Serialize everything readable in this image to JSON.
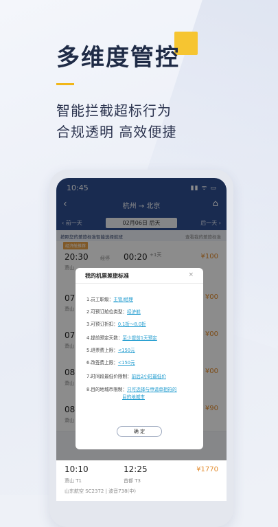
{
  "promo": {
    "headline": "多维度管控",
    "subline1": "智能拦截超标行为",
    "subline2": "合规透明 高效便捷"
  },
  "status": {
    "time": "10:45",
    "icons": "▮▮ ᯤ ▭"
  },
  "nav": {
    "back": "‹",
    "title": "杭州 → 北京",
    "home": "⌂"
  },
  "datebar": {
    "prev": "‹ 前一天",
    "current": "02月06日 后天",
    "next": "后一天 ›"
  },
  "notice": {
    "left": "按照您的差旅标准智能选择航班",
    "right": "查看我的差旅标准"
  },
  "tag": "经济舱推荐",
  "flights": [
    {
      "dep": "20:30",
      "stop": "经停",
      "arr": "00:20",
      "plus": "+1天",
      "price": "¥100",
      "airport": "萧山"
    },
    {
      "dep": "07",
      "price": "¥00",
      "airport": "萧山"
    },
    {
      "dep": "07",
      "price": "¥00",
      "airport": "萧山"
    },
    {
      "dep": "08",
      "price": "¥00",
      "airport": "萧山"
    },
    {
      "dep": "08",
      "price": "¥90",
      "airport": "萧山"
    },
    {
      "dep": "10:10",
      "arr": "12:25",
      "price": "¥1770",
      "airport": "萧山 T1",
      "arr_airport": "首都 T3",
      "note": "山东航空 SC2372 | 波音738(中)"
    }
  ],
  "modal": {
    "title": "我的机票差旅标准",
    "close": "×",
    "rules": [
      {
        "label": "1.员工职级：",
        "value": "主管/经理"
      },
      {
        "label": "2.可预订舱位类型：",
        "value": "经济舱"
      },
      {
        "label": "3.可预订折扣：",
        "value": "0.1折～8.0折"
      },
      {
        "label": "4.提前预定天数：",
        "value": "至少提前1天预定"
      },
      {
        "label": "5.退票费上限：",
        "value": "<150元"
      },
      {
        "label": "6.改签费上限：",
        "value": "<150元"
      },
      {
        "label": "7.时间段最低价限制：",
        "value": "前后2小时最低价"
      },
      {
        "label": "8.目的地城市限制：",
        "value": "只可选择与申请单相符的"
      },
      {
        "label": "",
        "value": "目的地城市"
      }
    ],
    "confirm": "确 定"
  }
}
